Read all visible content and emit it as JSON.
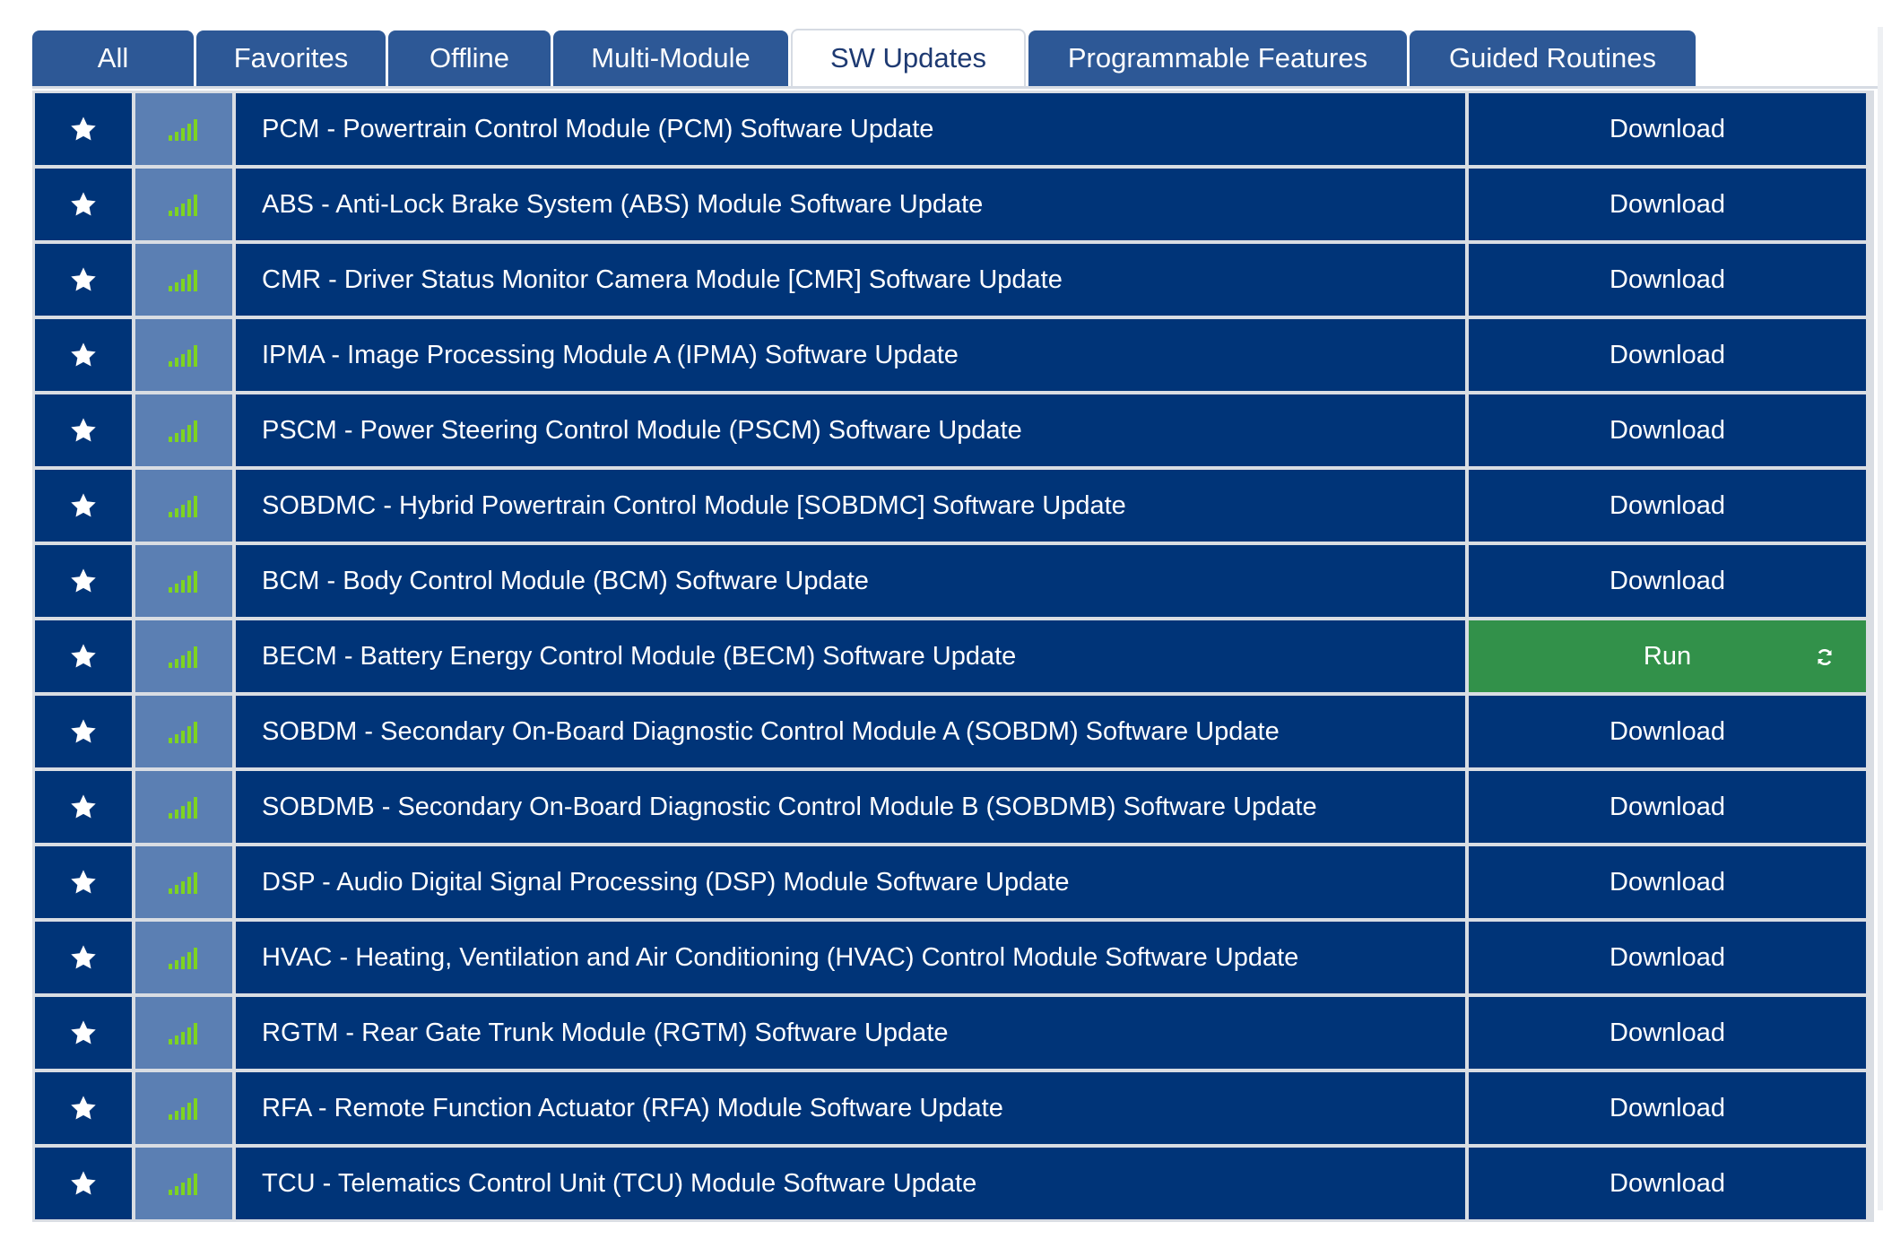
{
  "colors": {
    "row_bg": "#003478",
    "signal_cell_bg": "#5b7fb3",
    "signal_bars": "#7ed321",
    "run_button_bg": "#32914a",
    "tab_bg": "#2d5896"
  },
  "tabs": [
    {
      "label": "All",
      "active": false
    },
    {
      "label": "Favorites",
      "active": false
    },
    {
      "label": "Offline",
      "active": false
    },
    {
      "label": "Multi-Module",
      "active": false
    },
    {
      "label": "SW Updates",
      "active": true
    },
    {
      "label": "Programmable Features",
      "active": false
    },
    {
      "label": "Guided Routines",
      "active": false
    }
  ],
  "rows": [
    {
      "name": "PCM - Powertrain Control Module (PCM) Software Update",
      "action": "Download",
      "favorite_icon": "star-icon",
      "signal_icon": "signal-bars-icon"
    },
    {
      "name": "ABS - Anti-Lock Brake System (ABS) Module Software Update",
      "action": "Download",
      "favorite_icon": "star-icon",
      "signal_icon": "signal-bars-icon"
    },
    {
      "name": "CMR - Driver Status Monitor Camera Module [CMR] Software Update",
      "action": "Download",
      "favorite_icon": "star-icon",
      "signal_icon": "signal-bars-icon"
    },
    {
      "name": "IPMA - Image Processing Module A (IPMA) Software Update",
      "action": "Download",
      "favorite_icon": "star-icon",
      "signal_icon": "signal-bars-icon"
    },
    {
      "name": "PSCM - Power Steering Control Module (PSCM) Software Update",
      "action": "Download",
      "favorite_icon": "star-icon",
      "signal_icon": "signal-bars-icon"
    },
    {
      "name": "SOBDMC - Hybrid Powertrain Control Module [SOBDMC] Software Update",
      "action": "Download",
      "favorite_icon": "star-icon",
      "signal_icon": "signal-bars-icon"
    },
    {
      "name": "BCM - Body Control Module (BCM) Software Update",
      "action": "Download",
      "favorite_icon": "star-icon",
      "signal_icon": "signal-bars-icon"
    },
    {
      "name": "BECM - Battery Energy Control Module (BECM) Software Update",
      "action": "Run",
      "favorite_icon": "star-icon",
      "signal_icon": "signal-bars-icon",
      "action_icon": "refresh-icon"
    },
    {
      "name": "SOBDM - Secondary On-Board Diagnostic Control Module A (SOBDM) Software Update",
      "action": "Download",
      "favorite_icon": "star-icon",
      "signal_icon": "signal-bars-icon"
    },
    {
      "name": "SOBDMB - Secondary On-Board Diagnostic Control Module B (SOBDMB) Software Update",
      "action": "Download",
      "favorite_icon": "star-icon",
      "signal_icon": "signal-bars-icon"
    },
    {
      "name": "DSP - Audio Digital Signal Processing (DSP) Module Software Update",
      "action": "Download",
      "favorite_icon": "star-icon",
      "signal_icon": "signal-bars-icon"
    },
    {
      "name": "HVAC - Heating, Ventilation and Air Conditioning (HVAC) Control Module Software Update",
      "action": "Download",
      "favorite_icon": "star-icon",
      "signal_icon": "signal-bars-icon"
    },
    {
      "name": "RGTM - Rear Gate Trunk Module (RGTM) Software Update",
      "action": "Download",
      "favorite_icon": "star-icon",
      "signal_icon": "signal-bars-icon"
    },
    {
      "name": "RFA - Remote Function Actuator (RFA) Module Software Update",
      "action": "Download",
      "favorite_icon": "star-icon",
      "signal_icon": "signal-bars-icon"
    },
    {
      "name": "TCU - Telematics Control Unit (TCU) Module Software Update",
      "action": "Download",
      "favorite_icon": "star-icon",
      "signal_icon": "signal-bars-icon"
    }
  ]
}
